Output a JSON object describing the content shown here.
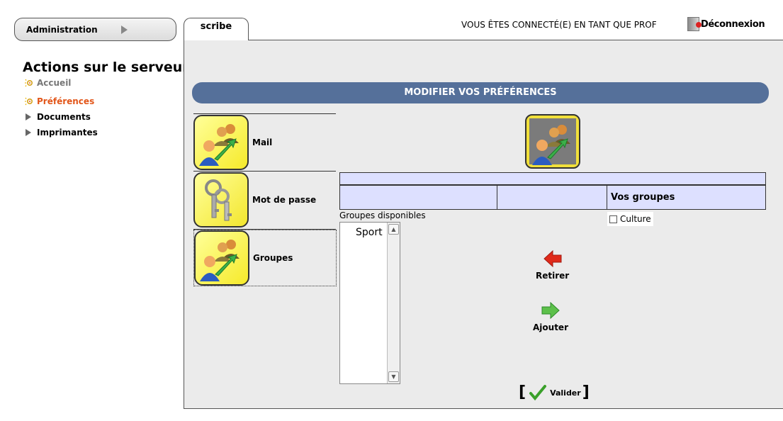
{
  "admin_menu": {
    "label": "Administration"
  },
  "sidebar": {
    "title": "Actions sur le serveur",
    "items": [
      {
        "label": "Accueil",
        "icon": "sun-icon",
        "color": "#777777"
      },
      {
        "label": "Préférences",
        "icon": "sun-icon",
        "color": "#e2561a"
      },
      {
        "label": "Documents",
        "icon": "triangle-icon",
        "color": "#000000"
      },
      {
        "label": "Imprimantes",
        "icon": "triangle-icon",
        "color": "#000000"
      }
    ]
  },
  "tab": {
    "label": "scribe"
  },
  "header": {
    "connected_text": "VOUS ÊTES CONNECTÉ(E) EN TANT QUE PROF",
    "logout_label": "Déconnexion"
  },
  "section": {
    "title": "MODIFIER VOS PRÉFÉRENCES",
    "color": "#55709a"
  },
  "pref_menu": {
    "items": [
      {
        "label": "Mail",
        "icon": "users-arrow-icon"
      },
      {
        "label": "Mot de passe",
        "icon": "keys-icon"
      },
      {
        "label": "Groupes",
        "icon": "users-arrow-icon"
      }
    ]
  },
  "groups": {
    "vos_groupes_header": "Vos groupes",
    "available_label": "Groupes disponibles",
    "available": [
      "Sport"
    ],
    "selected": [
      {
        "label": "Culture",
        "checked": false
      }
    ],
    "remove_label": "Retirer",
    "add_label": "Ajouter",
    "validate_label": "Valider",
    "bracket_open": "[",
    "bracket_close": "]"
  }
}
